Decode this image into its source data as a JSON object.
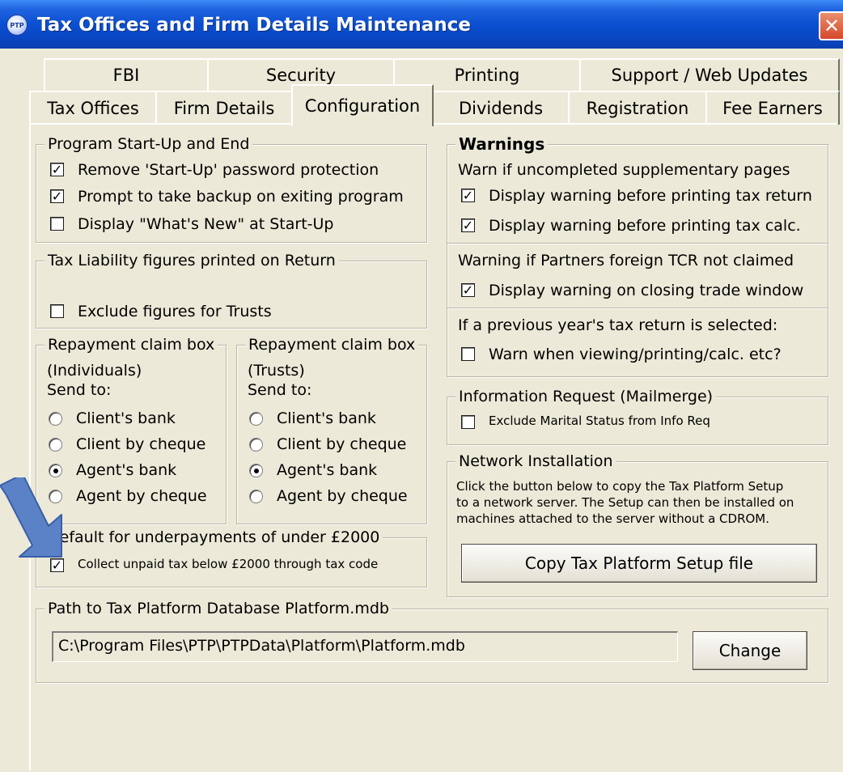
{
  "window": {
    "title": "Tax Offices and Firm Details Maintenance",
    "icon_label": "PTP",
    "close_glyph": "✕"
  },
  "tabs": {
    "row1": [
      "FBI",
      "Security",
      "Printing",
      "Support / Web Updates"
    ],
    "row2": [
      "Tax Offices",
      "Firm Details",
      "Configuration",
      "Dividends",
      "Registration",
      "Fee Earners"
    ],
    "active": "Configuration"
  },
  "startup": {
    "legend": "Program Start-Up and End",
    "items": [
      {
        "label": "Remove 'Start-Up' password protection",
        "checked": true
      },
      {
        "label": "Prompt to take backup on exiting program",
        "checked": true
      },
      {
        "label": "Display \"What's New\" at Start-Up",
        "checked": false
      }
    ]
  },
  "tax_liability": {
    "legend": "Tax Liability figures printed on Return",
    "item": {
      "label": "Exclude figures for Trusts",
      "checked": false
    }
  },
  "repay_individuals": {
    "legend": "Repayment claim box",
    "line1": "(Individuals)",
    "line2": "Send to:",
    "options": [
      "Client's bank",
      "Client by cheque",
      "Agent's bank",
      "Agent by cheque"
    ],
    "selected": "Agent's bank"
  },
  "repay_trusts": {
    "legend": "Repayment claim box",
    "line1": "(Trusts)",
    "line2": "Send to:",
    "options": [
      "Client's bank",
      "Client by cheque",
      "Agent's bank",
      "Agent by cheque"
    ],
    "selected": "Agent's bank"
  },
  "underpayments": {
    "legend": "Default for underpayments of under £2000",
    "item": {
      "label": "Collect unpaid tax below £2000 through tax code",
      "checked": true
    }
  },
  "warnings": {
    "legend": "Warnings",
    "section1_heading": "Warn if uncompleted supplementary pages",
    "section1_items": [
      {
        "label": "Display warning before printing tax return",
        "checked": true
      },
      {
        "label": "Display warning before printing tax calc.",
        "checked": true
      }
    ],
    "section2_heading": "Warning if Partners foreign TCR not claimed",
    "section2_item": {
      "label": "Display warning on closing trade window",
      "checked": true
    },
    "section3_heading": "If a previous year's tax return is selected:",
    "section3_item": {
      "label": "Warn when viewing/printing/calc. etc?",
      "checked": false
    }
  },
  "info_request": {
    "legend": "Information Request (Mailmerge)",
    "item": {
      "label": "Exclude Marital Status from Info Req",
      "checked": false
    }
  },
  "network": {
    "legend": "Network Installation",
    "lines": [
      "Click the button below to copy the Tax Platform Setup",
      "to a network server. The Setup can then be installed on",
      "machines attached to the server without a CDROM."
    ],
    "button_label": "Copy Tax Platform Setup file"
  },
  "database_path": {
    "legend": "Path to Tax Platform Database Platform.mdb",
    "value": "C:\\Program Files\\PTP\\PTPData\\Platform\\Platform.mdb",
    "change_label": "Change"
  },
  "colors": {
    "title_bar": "#0a4fd0",
    "panel": "#ece9d8",
    "annotation_arrow": "#5b82c7"
  }
}
